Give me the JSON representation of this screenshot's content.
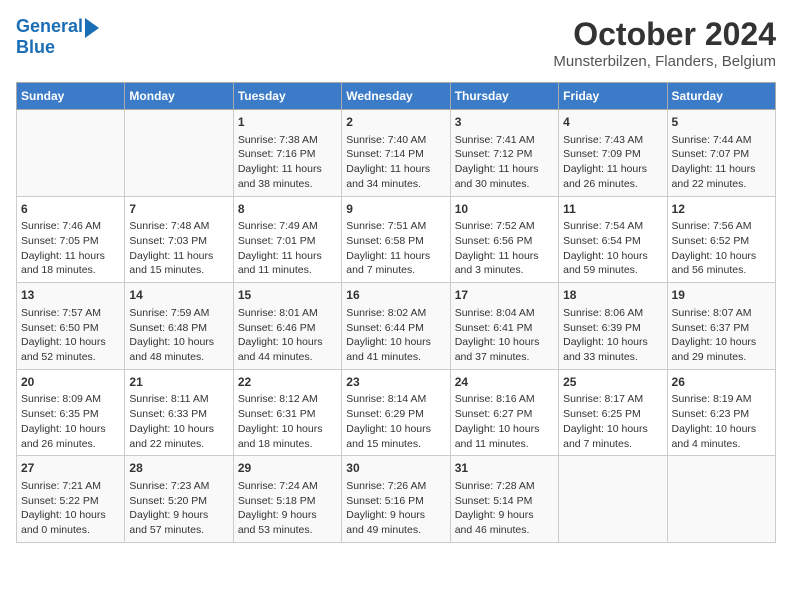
{
  "header": {
    "logo_line1": "General",
    "logo_line2": "Blue",
    "title": "October 2024",
    "subtitle": "Munsterbilzen, Flanders, Belgium"
  },
  "weekdays": [
    "Sunday",
    "Monday",
    "Tuesday",
    "Wednesday",
    "Thursday",
    "Friday",
    "Saturday"
  ],
  "weeks": [
    [
      {
        "day": "",
        "info": ""
      },
      {
        "day": "",
        "info": ""
      },
      {
        "day": "1",
        "info": "Sunrise: 7:38 AM\nSunset: 7:16 PM\nDaylight: 11 hours\nand 38 minutes."
      },
      {
        "day": "2",
        "info": "Sunrise: 7:40 AM\nSunset: 7:14 PM\nDaylight: 11 hours\nand 34 minutes."
      },
      {
        "day": "3",
        "info": "Sunrise: 7:41 AM\nSunset: 7:12 PM\nDaylight: 11 hours\nand 30 minutes."
      },
      {
        "day": "4",
        "info": "Sunrise: 7:43 AM\nSunset: 7:09 PM\nDaylight: 11 hours\nand 26 minutes."
      },
      {
        "day": "5",
        "info": "Sunrise: 7:44 AM\nSunset: 7:07 PM\nDaylight: 11 hours\nand 22 minutes."
      }
    ],
    [
      {
        "day": "6",
        "info": "Sunrise: 7:46 AM\nSunset: 7:05 PM\nDaylight: 11 hours\nand 18 minutes."
      },
      {
        "day": "7",
        "info": "Sunrise: 7:48 AM\nSunset: 7:03 PM\nDaylight: 11 hours\nand 15 minutes."
      },
      {
        "day": "8",
        "info": "Sunrise: 7:49 AM\nSunset: 7:01 PM\nDaylight: 11 hours\nand 11 minutes."
      },
      {
        "day": "9",
        "info": "Sunrise: 7:51 AM\nSunset: 6:58 PM\nDaylight: 11 hours\nand 7 minutes."
      },
      {
        "day": "10",
        "info": "Sunrise: 7:52 AM\nSunset: 6:56 PM\nDaylight: 11 hours\nand 3 minutes."
      },
      {
        "day": "11",
        "info": "Sunrise: 7:54 AM\nSunset: 6:54 PM\nDaylight: 10 hours\nand 59 minutes."
      },
      {
        "day": "12",
        "info": "Sunrise: 7:56 AM\nSunset: 6:52 PM\nDaylight: 10 hours\nand 56 minutes."
      }
    ],
    [
      {
        "day": "13",
        "info": "Sunrise: 7:57 AM\nSunset: 6:50 PM\nDaylight: 10 hours\nand 52 minutes."
      },
      {
        "day": "14",
        "info": "Sunrise: 7:59 AM\nSunset: 6:48 PM\nDaylight: 10 hours\nand 48 minutes."
      },
      {
        "day": "15",
        "info": "Sunrise: 8:01 AM\nSunset: 6:46 PM\nDaylight: 10 hours\nand 44 minutes."
      },
      {
        "day": "16",
        "info": "Sunrise: 8:02 AM\nSunset: 6:44 PM\nDaylight: 10 hours\nand 41 minutes."
      },
      {
        "day": "17",
        "info": "Sunrise: 8:04 AM\nSunset: 6:41 PM\nDaylight: 10 hours\nand 37 minutes."
      },
      {
        "day": "18",
        "info": "Sunrise: 8:06 AM\nSunset: 6:39 PM\nDaylight: 10 hours\nand 33 minutes."
      },
      {
        "day": "19",
        "info": "Sunrise: 8:07 AM\nSunset: 6:37 PM\nDaylight: 10 hours\nand 29 minutes."
      }
    ],
    [
      {
        "day": "20",
        "info": "Sunrise: 8:09 AM\nSunset: 6:35 PM\nDaylight: 10 hours\nand 26 minutes."
      },
      {
        "day": "21",
        "info": "Sunrise: 8:11 AM\nSunset: 6:33 PM\nDaylight: 10 hours\nand 22 minutes."
      },
      {
        "day": "22",
        "info": "Sunrise: 8:12 AM\nSunset: 6:31 PM\nDaylight: 10 hours\nand 18 minutes."
      },
      {
        "day": "23",
        "info": "Sunrise: 8:14 AM\nSunset: 6:29 PM\nDaylight: 10 hours\nand 15 minutes."
      },
      {
        "day": "24",
        "info": "Sunrise: 8:16 AM\nSunset: 6:27 PM\nDaylight: 10 hours\nand 11 minutes."
      },
      {
        "day": "25",
        "info": "Sunrise: 8:17 AM\nSunset: 6:25 PM\nDaylight: 10 hours\nand 7 minutes."
      },
      {
        "day": "26",
        "info": "Sunrise: 8:19 AM\nSunset: 6:23 PM\nDaylight: 10 hours\nand 4 minutes."
      }
    ],
    [
      {
        "day": "27",
        "info": "Sunrise: 7:21 AM\nSunset: 5:22 PM\nDaylight: 10 hours\nand 0 minutes."
      },
      {
        "day": "28",
        "info": "Sunrise: 7:23 AM\nSunset: 5:20 PM\nDaylight: 9 hours\nand 57 minutes."
      },
      {
        "day": "29",
        "info": "Sunrise: 7:24 AM\nSunset: 5:18 PM\nDaylight: 9 hours\nand 53 minutes."
      },
      {
        "day": "30",
        "info": "Sunrise: 7:26 AM\nSunset: 5:16 PM\nDaylight: 9 hours\nand 49 minutes."
      },
      {
        "day": "31",
        "info": "Sunrise: 7:28 AM\nSunset: 5:14 PM\nDaylight: 9 hours\nand 46 minutes."
      },
      {
        "day": "",
        "info": ""
      },
      {
        "day": "",
        "info": ""
      }
    ]
  ]
}
